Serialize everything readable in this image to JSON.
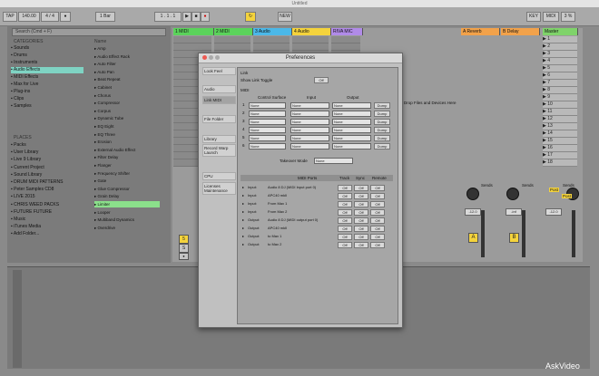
{
  "window": {
    "title": "Untitled"
  },
  "control_bar": {
    "tap": "TAP",
    "tempo": "140.00",
    "sig": "4 / 4",
    "quant": "1 Bar",
    "new": "NEW",
    "position": "1 . 1 . 1",
    "key": "KEY",
    "midi": "MIDI",
    "cpu": "3 %"
  },
  "browser": {
    "search_placeholder": "Search (Cmd + F)",
    "categories_header": "CATEGORIES",
    "name_header": "Name",
    "categories": [
      "Sounds",
      "Drums",
      "Instruments",
      "Audio Effects",
      "MIDI Effects",
      "Max for Live",
      "Plug-ins",
      "Clips",
      "Samples"
    ],
    "places_header": "PLACES",
    "places": [
      "Packs",
      "User Library",
      "Live 9 Library",
      "Current Project",
      "Sound Library",
      "DRUM MIDI PATTERNS",
      "Peter Samples CD8",
      "LIVE 2015",
      "CHRIS WEED PACKS",
      "FUTURE FUTURE",
      "Music",
      "iTunes Media",
      "Add Folder..."
    ],
    "names": [
      "Amp",
      "Audio Effect Rack",
      "Auto Filter",
      "Auto Pan",
      "Beat Repeat",
      "Cabinet",
      "Chorus",
      "Compressor",
      "Corpus",
      "Dynamic Tube",
      "EQ Eight",
      "EQ Three",
      "Erosion",
      "External Audio Effect",
      "Filter Delay",
      "Flanger",
      "Frequency Shifter",
      "Gate",
      "Glue Compressor",
      "Grain Delay",
      "Limiter",
      "Looper",
      "Multiband Dynamics",
      "Overdrive"
    ],
    "selected_category_index": 3,
    "selected_name_index": 20
  },
  "tracks": [
    {
      "name": "1 MIDI",
      "color": "#5bd35b"
    },
    {
      "name": "2 MIDI",
      "color": "#5bd35b"
    },
    {
      "name": "3 Audio",
      "color": "#4bb8e8"
    },
    {
      "name": "4 Audio",
      "color": "#f4d33c"
    },
    {
      "name": "RIVA MIC",
      "color": "#b18be8"
    }
  ],
  "returns": [
    {
      "name": "A Reverb",
      "color": "#f2a24a"
    },
    {
      "name": "B Delay",
      "color": "#f2a24a"
    }
  ],
  "master": {
    "name": "Master",
    "scenes": [
      "1",
      "2",
      "3",
      "4",
      "5",
      "6",
      "7",
      "8",
      "9",
      "10",
      "11",
      "12",
      "13",
      "14",
      "15",
      "16",
      "17",
      "18"
    ]
  },
  "drop_hint": "Drop Files and Devices Here",
  "sends_label": "Sends",
  "return_letters": [
    "A",
    "B"
  ],
  "master_meters": [
    "-12.0",
    "-inf",
    "0"
  ],
  "return_meters": [
    "-12.0",
    "-inf",
    "0"
  ],
  "post_label": "Post",
  "prefs": {
    "title": "Preferences",
    "tabs": [
      "Look Feel",
      "Audio",
      "Link MIDI",
      "File Folder",
      "Library",
      "Record Warp Launch",
      "CPU",
      "Licenses Maintenance"
    ],
    "selected_tab": 2,
    "link_header": "Link",
    "link_label": "Show Link Toggle",
    "link_value": "Off",
    "midi_header": "MIDI",
    "cols": [
      "Control Surface",
      "Input",
      "Output"
    ],
    "slots": [
      "1",
      "2",
      "3",
      "4",
      "5",
      "6"
    ],
    "none": "None",
    "dump": "Dump",
    "takeover_label": "Takeover Mode",
    "takeover_value": "None",
    "ports_header": [
      "MIDI Ports",
      "Track",
      "Sync",
      "Remote"
    ],
    "ports": [
      {
        "dir": "Input:",
        "name": "Audio 8 DJ (MIDI Input port 0)"
      },
      {
        "dir": "Input:",
        "name": "APC40 mkII"
      },
      {
        "dir": "Input:",
        "name": "From Max 1"
      },
      {
        "dir": "Input:",
        "name": "From Max 2"
      },
      {
        "dir": "Output:",
        "name": "Audio 8 DJ (MIDI output port 0)"
      },
      {
        "dir": "Output:",
        "name": "APC40 mkII"
      },
      {
        "dir": "Output:",
        "name": "to Max 1"
      },
      {
        "dir": "Output:",
        "name": "to Max 2"
      }
    ],
    "off": "Off"
  },
  "watermark": "AskVideo"
}
